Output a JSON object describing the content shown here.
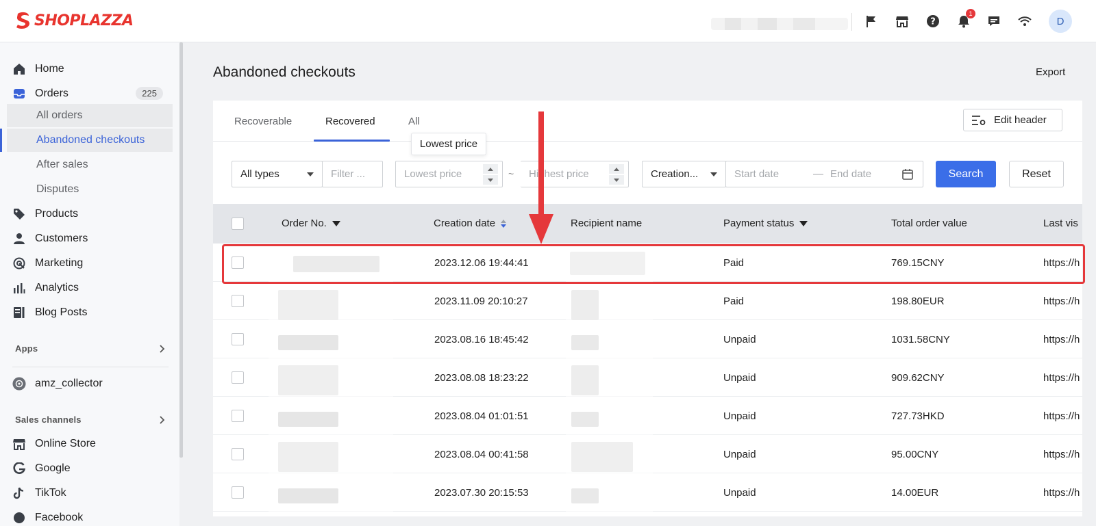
{
  "brand": {
    "name": "SHOPLAZZA",
    "color": "#e8342e"
  },
  "topbar": {
    "icons": [
      "flag-icon",
      "store-icon",
      "help-icon",
      "bell-icon",
      "chat-icon",
      "wifi-icon"
    ],
    "notification_count": "1",
    "avatar_initial": "D"
  },
  "sidebar": {
    "home": "Home",
    "orders": "Orders",
    "orders_count": "225",
    "orders_sub": [
      "All orders",
      "Abandoned checkouts",
      "After sales",
      "Disputes"
    ],
    "products": "Products",
    "customers": "Customers",
    "marketing": "Marketing",
    "analytics": "Analytics",
    "blog_posts": "Blog Posts",
    "apps_label": "Apps",
    "app_item": "amz_collector",
    "sales_channels_label": "Sales channels",
    "channels": [
      "Online Store",
      "Google",
      "TikTok",
      "Facebook"
    ]
  },
  "page": {
    "title": "Abandoned checkouts",
    "export": "Export"
  },
  "tabs": {
    "items": [
      "Recoverable",
      "Recovered",
      "All"
    ],
    "active": "Recovered"
  },
  "toolbar": {
    "edit_header": "Edit header"
  },
  "tooltip": "Lowest price",
  "filters": {
    "type_value": "All types",
    "filter_placeholder": "Filter ...",
    "lowest_price_placeholder": "Lowest price",
    "range_separator": "~",
    "highest_price_placeholder": "Highest price",
    "date_field_value": "Creation...",
    "start_date_placeholder": "Start date",
    "date_separator": "—",
    "end_date_placeholder": "End date",
    "search": "Search",
    "reset": "Reset"
  },
  "table": {
    "headers": {
      "order_no": "Order No.",
      "creation_date": "Creation date",
      "recipient_name": "Recipient name",
      "payment_status": "Payment status",
      "total_order_value": "Total order value",
      "last_visited": "Last vis"
    },
    "rows": [
      {
        "creation_date": "2023.12.06 19:44:41",
        "payment_status": "Paid",
        "total": "769.15CNY",
        "url": "https://h"
      },
      {
        "creation_date": "2023.11.09 20:10:27",
        "payment_status": "Paid",
        "total": "198.80EUR",
        "url": "https://h"
      },
      {
        "creation_date": "2023.08.16 18:45:42",
        "payment_status": "Unpaid",
        "total": "1031.58CNY",
        "url": "https://h"
      },
      {
        "creation_date": "2023.08.08 18:23:22",
        "payment_status": "Unpaid",
        "total": "909.62CNY",
        "url": "https://h"
      },
      {
        "creation_date": "2023.08.04 01:01:51",
        "payment_status": "Unpaid",
        "total": "727.73HKD",
        "url": "https://h"
      },
      {
        "creation_date": "2023.08.04 00:41:58",
        "payment_status": "Unpaid",
        "total": "95.00CNY",
        "url": "https://h"
      },
      {
        "creation_date": "2023.07.30 20:15:53",
        "payment_status": "Unpaid",
        "total": "14.00EUR",
        "url": "https://h"
      }
    ]
  },
  "colors": {
    "accent": "#3b63d8",
    "primary_button": "#3b6ee8",
    "annotation": "#e5383b"
  }
}
